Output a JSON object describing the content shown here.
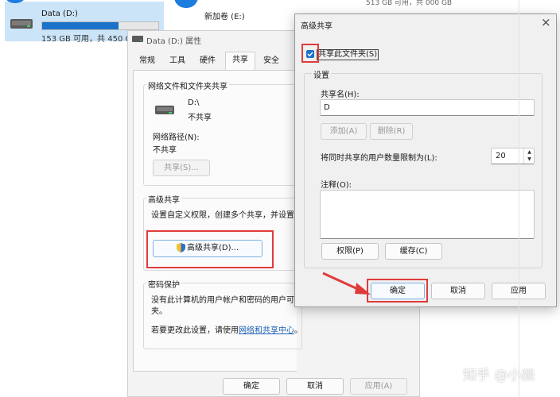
{
  "explorer": {
    "drive_d_name": "Data (D:)",
    "drive_d_space": "153 GB 可用，共 450 GB",
    "drive_d_used_fraction": 0.66,
    "drive_e_name": "新加卷 (E:)",
    "drive_e_space_partial": "513 GB 可用，共 000 GB"
  },
  "props": {
    "title": "Data (D:) 属性",
    "tabs": [
      "常规",
      "工具",
      "硬件",
      "共享",
      "安全"
    ],
    "section_network": "网络文件和文件夹共享",
    "drive_label": "D:\\",
    "drive_status": "不共享",
    "path_label": "网络路径(N):",
    "path_value": "不共享",
    "share_button": "共享(S)...",
    "section_advanced": "高级共享",
    "advanced_desc": "设置自定义权限，创建多个共享，并设置其",
    "advanced_button": "高级共享(D)...",
    "section_password": "密码保护",
    "password_desc_1": "没有此计算机的用户帐户和密码的用户可以",
    "password_desc_2": "夹。",
    "password_desc_3": "若要更改此设置，请使用",
    "password_link": "网络和共享中心",
    "password_desc_end": "。",
    "ok": "确定",
    "cancel": "取消",
    "apply": "应用(A)"
  },
  "adv": {
    "title": "高级共享",
    "close": "×",
    "share_checkbox_label": "共享此文件夹(S)",
    "share_checked": true,
    "settings_label": "设置",
    "share_name_label": "共享名(H):",
    "share_name_value": "D",
    "add_button": "添加(A)",
    "remove_button": "删除(R)",
    "limit_label": "将同时共享的用户数量限制为(L):",
    "limit_value": "20",
    "comment_label": "注释(O):",
    "comment_value": "",
    "permissions_button": "权限(P)",
    "cache_button": "缓存(C)",
    "ok": "确定",
    "cancel": "取消",
    "apply": "应用"
  },
  "watermark": "知乎 @小燚",
  "colors": {
    "accent": "#1a73c9",
    "highlight": "#e03b3b",
    "link": "#1a5fb4"
  }
}
